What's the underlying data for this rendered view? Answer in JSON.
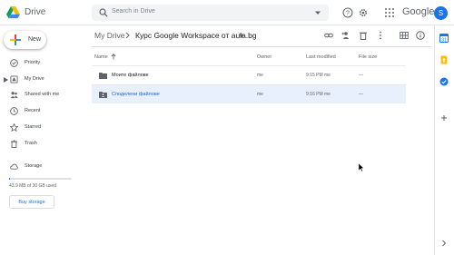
{
  "app": {
    "name": "Drive",
    "brand_word": "Google",
    "avatar_letter": "S"
  },
  "search": {
    "placeholder": "Search in Drive"
  },
  "sidebar": {
    "new_label": "New",
    "items": [
      {
        "label": "Priority",
        "icon": "checkbox-icon"
      },
      {
        "label": "My Drive",
        "icon": "drive-icon"
      },
      {
        "label": "Shared with me",
        "icon": "people-icon"
      },
      {
        "label": "Recent",
        "icon": "clock-icon"
      },
      {
        "label": "Starred",
        "icon": "star-icon"
      },
      {
        "label": "Trash",
        "icon": "trash-icon"
      }
    ],
    "storage_label": "Storage",
    "storage_used_text": "43.9 MB of 30 GB used",
    "storage_used_fraction": 0.0015,
    "buy_label": "Buy storage"
  },
  "breadcrumb": {
    "root": "My Drive",
    "current": "Курс Google Workspace от aula.bg"
  },
  "table": {
    "headers": {
      "name": "Name",
      "owner": "Owner",
      "modified": "Last modified",
      "size": "File size"
    },
    "rows": [
      {
        "name": "Моите файлове",
        "owner": "me",
        "modified": "9:15 PM  me",
        "size": "—",
        "icon": "folder-icon",
        "selected": false
      },
      {
        "name": "Споделени файлове",
        "owner": "me",
        "modified": "9:16 PM  me",
        "size": "—",
        "icon": "shared-folder-icon",
        "selected": true
      }
    ]
  },
  "colors": {
    "accent": "#1a73e8",
    "selected_row": "#e8f0fe",
    "selected_text": "#1967d2"
  }
}
